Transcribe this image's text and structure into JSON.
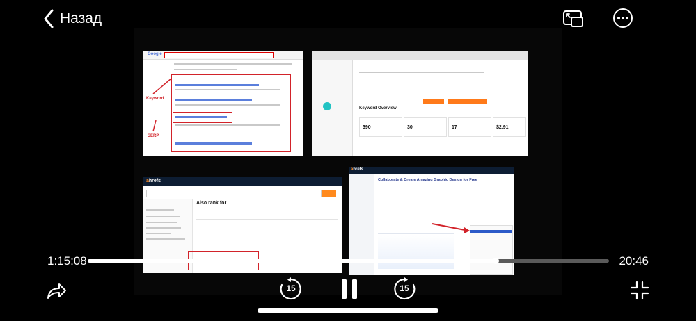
{
  "header": {
    "back_label": "Назад",
    "pip_icon": "picture-in-picture-icon",
    "more_icon": "more-ellipsis-icon"
  },
  "video": {
    "panels": {
      "serp": {
        "logo": "Google",
        "labels": [
          "Keyword",
          "SERP"
        ]
      },
      "semrush": {
        "title": "Keyword Overview",
        "kpis": [
          "390",
          "30",
          "17",
          "$2.91"
        ]
      },
      "ahrefs_keywords": {
        "brand_a": "a",
        "brand_rest": "hrefs",
        "heading": "Also rank for"
      },
      "ahrefs_site": {
        "brand_a": "a",
        "brand_rest": "hrefs",
        "title": "Collaborate & Create Amazing Graphic Design for Free"
      }
    }
  },
  "playback": {
    "elapsed": "1:15:08",
    "remaining": "20:46",
    "progress": 0.783,
    "skip_back_seconds": "15",
    "skip_forward_seconds": "15"
  },
  "colors": {
    "accent_red": "#d2232a",
    "ahrefs_orange": "#ff8a1e",
    "semrush_orange": "#ff7a1a"
  }
}
